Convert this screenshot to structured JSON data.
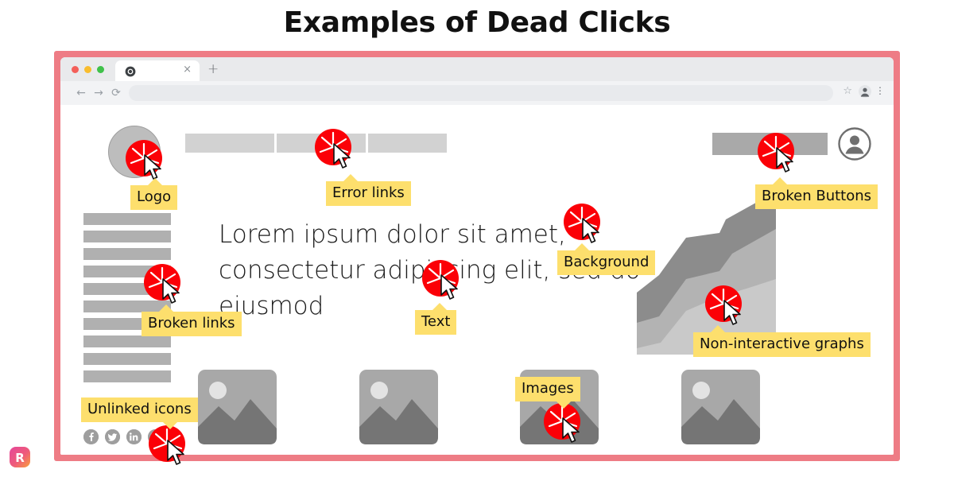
{
  "page": {
    "title": "Examples of Dead Clicks",
    "frame_color": "#ee7c85",
    "tooltip_color": "#fddf6d",
    "click_color": "#fb0007"
  },
  "browser": {
    "traffic_lights": [
      "close-red",
      "minimize-amber",
      "maximize-green"
    ],
    "tab": {
      "favicon": "chrome-favicon",
      "title": "",
      "close_label": "×"
    },
    "new_tab_label": "+",
    "nav": {
      "back": "←",
      "forward": "→",
      "reload": "⟳"
    },
    "omnibox": {
      "value": "",
      "placeholder": ""
    },
    "omni_star": "☆",
    "omni_menu": "⋮"
  },
  "site": {
    "logo_name": "site-logo",
    "nav_links": [
      "",
      "",
      ""
    ],
    "cta_label": "",
    "avatar_name": "user-avatar",
    "sidebar_items": [
      "",
      "",
      "",
      "",
      "",
      "",
      "",
      "",
      "",
      ""
    ],
    "body_copy": "Lorem ipsum dolor sit amet, consectetur adipiscing elit, sed do eiusmod",
    "thumbnails": [
      "image-placeholder-1",
      "image-placeholder-2",
      "image-placeholder-3",
      "image-placeholder-4"
    ],
    "social_icons": [
      "facebook",
      "twitter",
      "linkedin",
      "instagram"
    ]
  },
  "chart_data": {
    "type": "area",
    "title": "",
    "xlabel": "",
    "ylabel": "",
    "grid": false,
    "legend": "none",
    "x": [
      0,
      1,
      2,
      3,
      4,
      5
    ],
    "series": [
      {
        "name": "bottom-layer",
        "color": "#c9c9c9",
        "values": [
          4,
          10,
          22,
          34,
          46,
          62
        ]
      },
      {
        "name": "middle-layer",
        "color": "#b3b3b3",
        "values": [
          14,
          20,
          46,
          52,
          70,
          88
        ]
      },
      {
        "name": "top-layer",
        "color": "#8c8c8c",
        "values": [
          38,
          48,
          70,
          72,
          88,
          100
        ]
      }
    ],
    "ylim": [
      0,
      100
    ]
  },
  "annotations": [
    {
      "id": "logo",
      "label": "Logo",
      "beak": "up"
    },
    {
      "id": "error-links",
      "label": "Error links",
      "beak": "up"
    },
    {
      "id": "broken-buttons",
      "label": "Broken Buttons",
      "beak": "up"
    },
    {
      "id": "broken-links",
      "label": "Broken links",
      "beak": "up"
    },
    {
      "id": "text",
      "label": "Text",
      "beak": "up"
    },
    {
      "id": "background",
      "label": "Background",
      "beak": "up"
    },
    {
      "id": "graphs",
      "label": "Non-interactive graphs",
      "beak": "up"
    },
    {
      "id": "images",
      "label": "Images",
      "beak": "down"
    },
    {
      "id": "unlinked",
      "label": "Unlinked icons",
      "beak": "down"
    }
  ],
  "watermark": {
    "letter": "R"
  }
}
